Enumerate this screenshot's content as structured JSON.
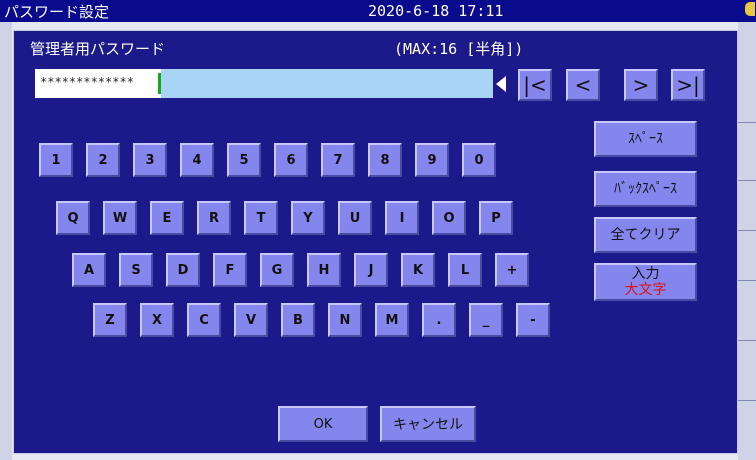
{
  "window": {
    "title": "パスワード設定",
    "datetime": "2020-6-18 17:11"
  },
  "dialog": {
    "title": "管理者用パスワード",
    "max_label": "(MAX:16 [半角])"
  },
  "password": {
    "masked_value": "*************"
  },
  "nav": {
    "first": "|<",
    "prev": "<",
    "next": ">",
    "last": ">|"
  },
  "keys": {
    "row1": [
      "1",
      "2",
      "3",
      "4",
      "5",
      "6",
      "7",
      "8",
      "9",
      "0"
    ],
    "row2": [
      "Q",
      "W",
      "E",
      "R",
      "T",
      "Y",
      "U",
      "I",
      "O",
      "P"
    ],
    "row3": [
      "A",
      "S",
      "D",
      "F",
      "G",
      "H",
      "J",
      "K",
      "L",
      "+"
    ],
    "row4": [
      "Z",
      "X",
      "C",
      "V",
      "B",
      "N",
      "M",
      ".",
      "_",
      "-"
    ]
  },
  "side": {
    "space": "ｽﾍﾟｰｽ",
    "backspace": "ﾊﾞｯｸｽﾍﾟｰｽ",
    "clear_all": "全てクリア",
    "input_label": "入力",
    "input_mode": "大文字"
  },
  "footer": {
    "ok": "OK",
    "cancel": "キャンセル"
  },
  "colors": {
    "title_bar": "#0a0a8c",
    "dialog_bg": "#1c1a8a",
    "key_bg": "#8486ee",
    "caret": "#18a818",
    "input_mode_text": "#e01010"
  }
}
